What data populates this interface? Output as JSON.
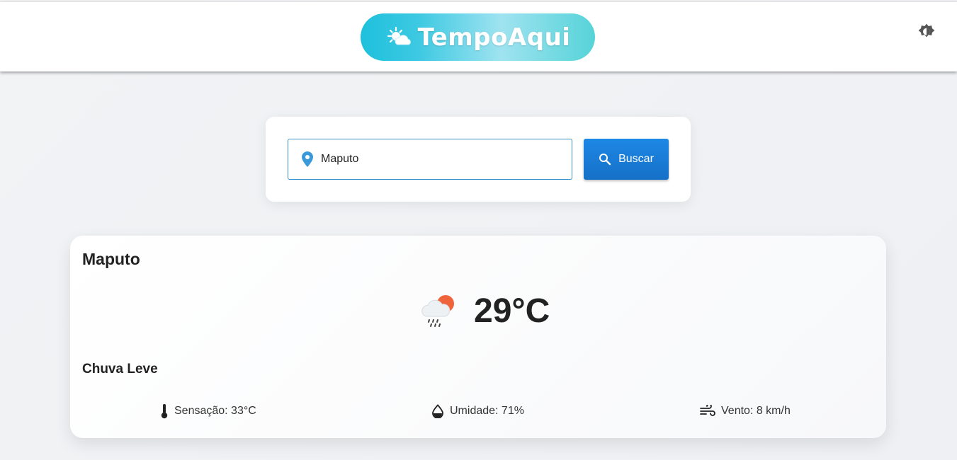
{
  "header": {
    "brand": "TempoAqui",
    "logo_icon": "sun-cloud-icon",
    "theme_toggle_icon": "brightness-icon"
  },
  "search": {
    "value": "Maputo",
    "placeholder": "",
    "field_icon": "location-pin-icon",
    "button_label": "Buscar",
    "button_icon": "search-icon"
  },
  "weather": {
    "city": "Maputo",
    "temperature": "29°C",
    "condition_icon": "rain-cloud-sun-icon",
    "description": "Chuva Leve",
    "details": {
      "feels_like": "Sensação: 33°C",
      "humidity": "Umidade: 71%",
      "wind": "Vento: 8 km/h"
    }
  },
  "colors": {
    "accent_blue": "#1d88e5",
    "logo_cyan": "#1ec0dc",
    "pin_blue": "#3a9ad9",
    "sun_orange": "#f0643c"
  }
}
